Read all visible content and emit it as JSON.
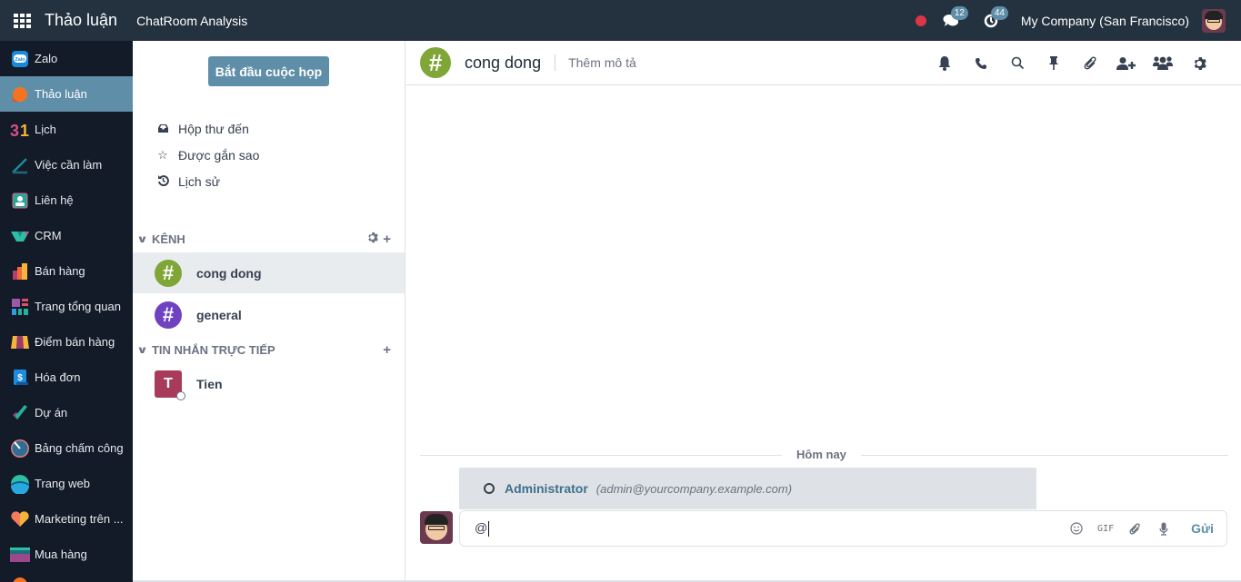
{
  "topbar": {
    "app_title": "Thảo luận",
    "menu_item": "ChatRoom Analysis",
    "messages_badge": "12",
    "activity_badge": "44",
    "company": "My Company (San Francisco)",
    "icons": [
      "apps-grid-icon",
      "recording-dot-icon",
      "chat-bubbles-icon",
      "activity-clock-icon",
      "user-avatar"
    ]
  },
  "sidebar": {
    "items": [
      {
        "label": "Zalo",
        "icon": "zalo-icon",
        "active": false
      },
      {
        "label": "Thảo luận",
        "icon": "discuss-icon",
        "active": true
      },
      {
        "label": "Lịch",
        "icon": "calendar-icon",
        "active": false
      },
      {
        "label": "Việc cần làm",
        "icon": "todo-icon",
        "active": false
      },
      {
        "label": "Liên hệ",
        "icon": "contacts-icon",
        "active": false
      },
      {
        "label": "CRM",
        "icon": "crm-icon",
        "active": false
      },
      {
        "label": "Bán hàng",
        "icon": "sales-icon",
        "active": false
      },
      {
        "label": "Trang tổng quan",
        "icon": "dashboard-icon",
        "active": false
      },
      {
        "label": "Điểm bán hàng",
        "icon": "pos-icon",
        "active": false
      },
      {
        "label": "Hóa đơn",
        "icon": "invoice-icon",
        "active": false
      },
      {
        "label": "Dự án",
        "icon": "project-icon",
        "active": false
      },
      {
        "label": "Bảng chấm công",
        "icon": "timesheet-icon",
        "active": false
      },
      {
        "label": "Trang web",
        "icon": "website-icon",
        "active": false
      },
      {
        "label": "Marketing trên ...",
        "icon": "marketing-icon",
        "active": false
      },
      {
        "label": "Mua hàng",
        "icon": "purchase-icon",
        "active": false
      }
    ]
  },
  "panel": {
    "start_meeting": "Bắt đầu cuộc họp",
    "nav": [
      {
        "label": "Hộp thư đến",
        "icon": "inbox-icon"
      },
      {
        "label": "Được gắn sao",
        "icon": "star-icon"
      },
      {
        "label": "Lịch sử",
        "icon": "history-icon"
      }
    ],
    "channels_header": "KÊNH",
    "channels": [
      {
        "name": "cong dong",
        "color": "#7fa637",
        "active": true
      },
      {
        "name": "general",
        "color": "#6f42c1",
        "active": false
      }
    ],
    "dm_header": "TIN NHẮN TRỰC TIẾP",
    "direct_messages": [
      {
        "name": "Tien",
        "initial": "T",
        "color": "#a83b5c",
        "status": "offline"
      }
    ]
  },
  "thread": {
    "name": "cong dong",
    "description_placeholder": "Thêm mô tả",
    "actions": [
      "bell-icon",
      "phone-icon",
      "search-icon",
      "pin-icon",
      "paperclip-icon",
      "add-user-icon",
      "members-icon",
      "gear-icon"
    ],
    "date_divider": "Hôm nay"
  },
  "mention_suggestion": {
    "name": "Administrator",
    "email": "(admin@yourcompany.example.com)"
  },
  "composer": {
    "value": "@",
    "gif_label": "GIF",
    "send_label": "Gửi"
  },
  "colors": {
    "topbar": "#24323f",
    "sidebar": "#131a28",
    "accent": "#5f8ea8",
    "record": "#dc3545"
  }
}
